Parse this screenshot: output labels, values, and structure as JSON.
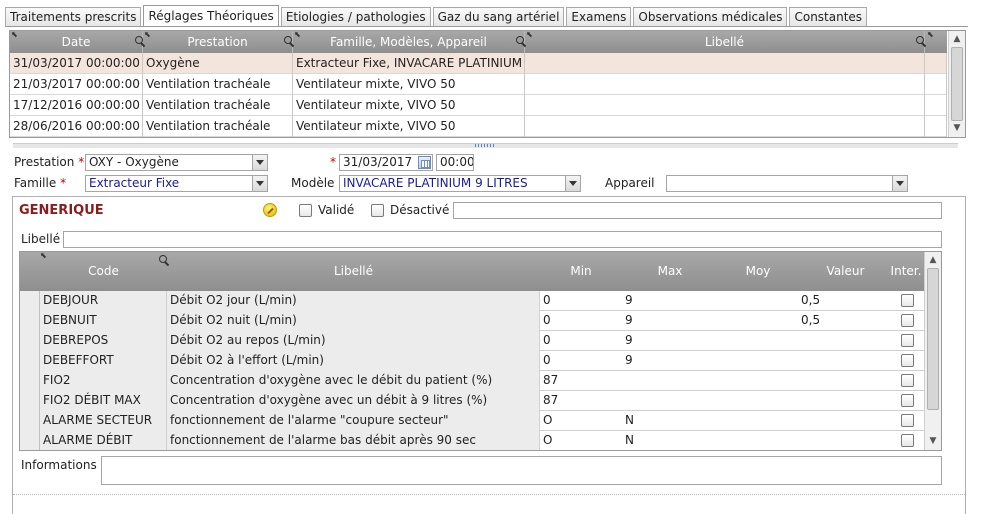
{
  "tabs": [
    {
      "label": "Traitements prescrits",
      "active": false
    },
    {
      "label": "Réglages Théoriques",
      "active": true
    },
    {
      "label": "Etiologies / pathologies",
      "active": false
    },
    {
      "label": "Gaz du sang artériel",
      "active": false
    },
    {
      "label": "Examens",
      "active": false
    },
    {
      "label": "Observations médicales",
      "active": false
    },
    {
      "label": "Constantes",
      "active": false
    }
  ],
  "prescriptions_grid": {
    "columns": [
      "Date",
      "Prestation",
      "Famille, Modèles, Appareil",
      "Libellé"
    ],
    "rows": [
      {
        "date": "31/03/2017 00:00:00",
        "prestation": "Oxygène",
        "famille": "Extracteur Fixe, INVACARE PLATINIUM",
        "libelle": "",
        "selected": true
      },
      {
        "date": "21/03/2017 00:00:00",
        "prestation": "Ventilation trachéale",
        "famille": "Ventilateur mixte, VIVO 50",
        "libelle": "",
        "selected": false
      },
      {
        "date": "17/12/2016 00:00:00",
        "prestation": "Ventilation trachéale",
        "famille": "Ventilateur mixte, VIVO 50",
        "libelle": "",
        "selected": false
      },
      {
        "date": "28/06/2016 00:00:00",
        "prestation": "Ventilation trachéale",
        "famille": "Ventilateur mixte, VIVO 50",
        "libelle": "",
        "selected": false
      }
    ]
  },
  "form": {
    "prestation_label": "Prestation",
    "prestation_value": "OXY - Oxygène",
    "required_mark": "*",
    "date_value": "31/03/2017",
    "time_value": "00:00",
    "famille_label": "Famille",
    "famille_value": "Extracteur Fixe",
    "modele_label": "Modèle",
    "modele_value": "INVACARE PLATINIUM 9 LITRES",
    "appareil_label": "Appareil",
    "appareil_value": ""
  },
  "generic": {
    "title": "GENERIQUE",
    "valide_label": "Validé",
    "desactive_label": "Désactivé",
    "libelle_label": "Libellé",
    "libelle_value": ""
  },
  "settings_grid": {
    "columns": [
      "Code",
      "Libellé",
      "Min",
      "Max",
      "Moy",
      "Valeur",
      "Inter."
    ],
    "rows": [
      {
        "code": "DEBJOUR",
        "libelle": "Débit O2 jour (L/min)",
        "min": "0",
        "max": "9",
        "moy": "",
        "valeur": "0,5"
      },
      {
        "code": "DEBNUIT",
        "libelle": "Débit O2 nuit (L/min)",
        "min": "0",
        "max": "9",
        "moy": "",
        "valeur": "0,5"
      },
      {
        "code": "DEBREPOS",
        "libelle": "Débit O2 au repos (L/min)",
        "min": "0",
        "max": "9",
        "moy": "",
        "valeur": ""
      },
      {
        "code": "DEBEFFORT",
        "libelle": "Débit O2 à l'effort (L/min)",
        "min": "0",
        "max": "9",
        "moy": "",
        "valeur": ""
      },
      {
        "code": "FIO2",
        "libelle": "Concentration d'oxygène avec le débit du patient (%)",
        "min": "87",
        "max": "",
        "moy": "",
        "valeur": ""
      },
      {
        "code": "FIO2 DÉBIT MAX",
        "libelle": "Concentration d'oxygène avec un débit à 9 litres (%)",
        "min": "87",
        "max": "",
        "moy": "",
        "valeur": ""
      },
      {
        "code": "ALARME SECTEUR",
        "libelle": "fonctionnement de l'alarme \"coupure secteur\"",
        "min": "O",
        "max": "N",
        "moy": "",
        "valeur": ""
      },
      {
        "code": "ALARME DÉBIT",
        "libelle": "fonctionnement de l'alarme bas débit après 90 sec",
        "min": "O",
        "max": "N",
        "moy": "",
        "valeur": ""
      }
    ]
  },
  "informations_label": "Informations",
  "colors": {
    "grid_header": "#9a9a9a",
    "selected_row": "#f3e5dc",
    "title_red": "#8a1c1c",
    "required_red": "#c00000",
    "field_blue": "#1a1a9c"
  }
}
